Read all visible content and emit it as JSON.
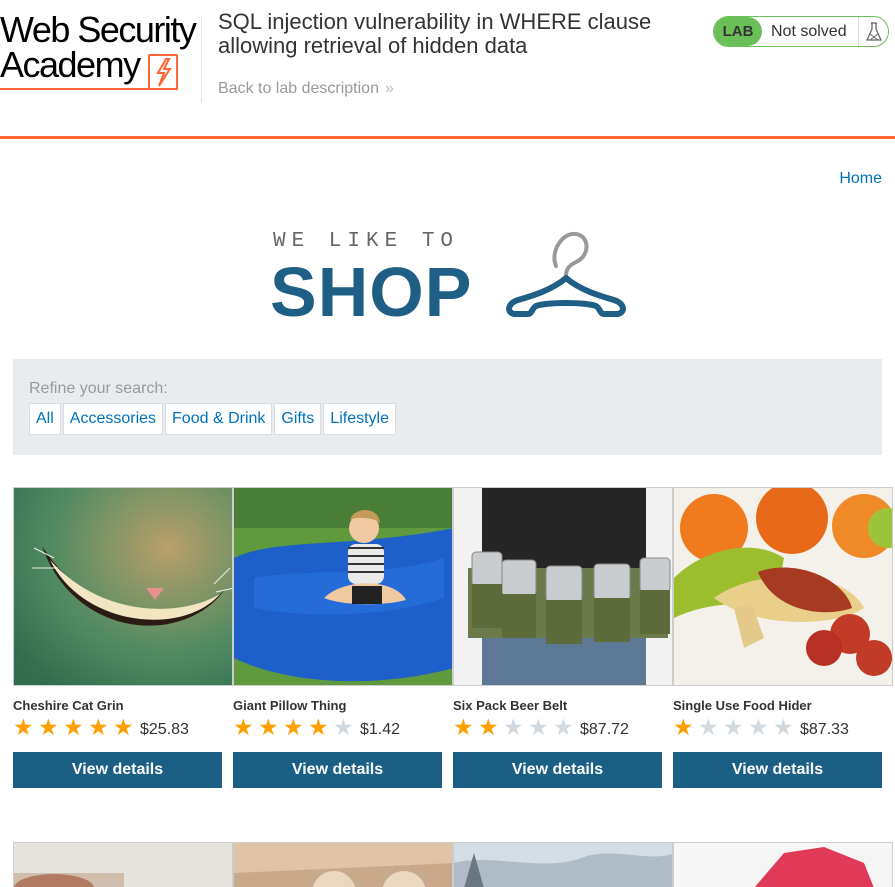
{
  "header": {
    "logo_lines": [
      "Web Security",
      "Academy"
    ],
    "lab_title": "SQL injection vulnerability in WHERE clause allowing retrieval of hidden data",
    "back_link": "Back to lab description",
    "lab_badge": "LAB",
    "lab_status": "Not solved"
  },
  "nav": {
    "home": "Home"
  },
  "banner": {
    "tagline": "WE LIKE TO",
    "title": "SHOP"
  },
  "filter": {
    "label": "Refine your search:",
    "categories": [
      "All",
      "Accessories",
      "Food & Drink",
      "Gifts",
      "Lifestyle"
    ]
  },
  "products": [
    {
      "name": "Cheshire Cat Grin",
      "rating": 5,
      "price": "$25.83",
      "button": "View details",
      "image": "cheshire-cat-grin-image"
    },
    {
      "name": "Giant Pillow Thing",
      "rating": 4,
      "price": "$1.42",
      "button": "View details",
      "image": "girl-on-blue-pillow-image"
    },
    {
      "name": "Six Pack Beer Belt",
      "rating": 2,
      "price": "$87.72",
      "button": "View details",
      "image": "beer-belt-image"
    },
    {
      "name": "Single Use Food Hider",
      "rating": 1,
      "price": "$87.33",
      "button": "View details",
      "image": "food-hider-image"
    }
  ],
  "colors": {
    "accent": "#ff6633",
    "link": "#0071bc",
    "button": "#1b5f84",
    "lab_green": "#6bbf59",
    "star_on": "#ff9f00",
    "star_off": "#d3dadf"
  }
}
